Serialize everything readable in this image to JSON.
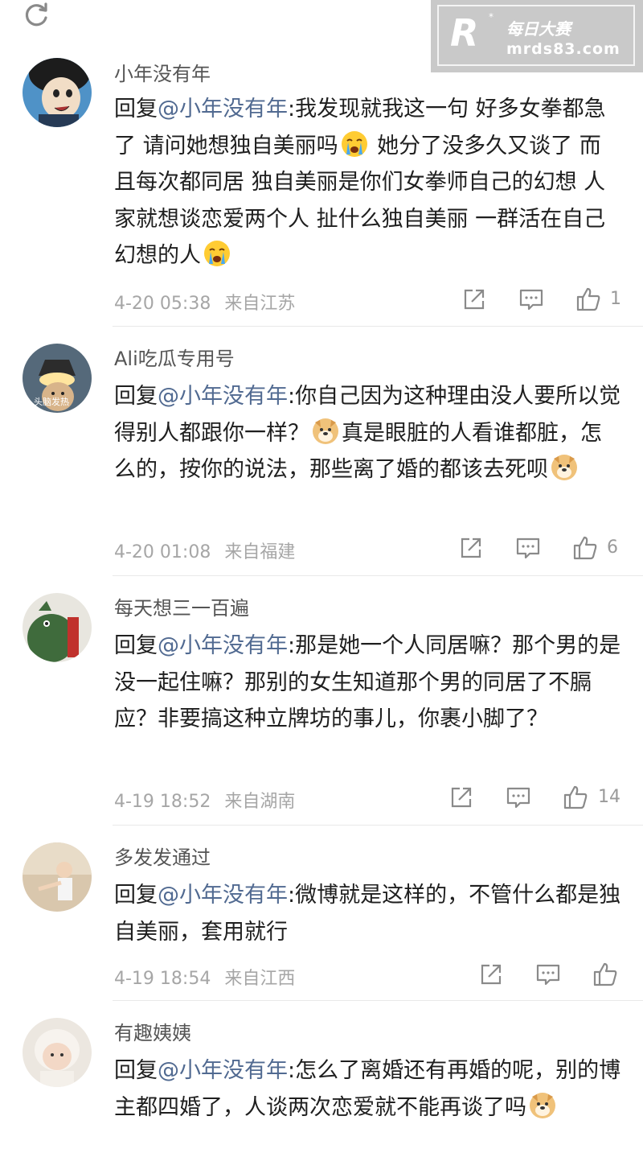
{
  "watermark": {
    "title": "每日大赛",
    "url": "mrds83.com",
    "logo_letter": "R",
    "logo_star": "*"
  },
  "comments": [
    {
      "username": "小年没有年",
      "prefix": "回复",
      "mention": "@小年没有年",
      "text_parts": [
        ":我发现就我这一句 好多女拳都急了 请问她想独自美丽吗",
        "[cry]",
        " 她分了没多久又谈了 而且每次都同居 独自美丽是你们女拳师自己的幻想 人家就想谈恋爱两个人 扯什么独自美丽 一群活在自己幻想的人",
        "[cry]"
      ],
      "time": "4-20 05:38",
      "location": "来自江苏",
      "likes": "1"
    },
    {
      "username": "Ali吃瓜专用号",
      "prefix": "回复",
      "mention": "@小年没有年",
      "text_parts": [
        ":你自己因为这种理由没人要所以觉得别人都跟你一样？",
        "[doge]",
        "真是眼脏的人看谁都脏，怎么的，按你的说法，那些离了婚的都该去死呗",
        "[doge]"
      ],
      "time": "4-20 01:08",
      "location": "来自福建",
      "likes": "6",
      "avatar_caption": "头脑发热"
    },
    {
      "username": "每天想三一百遍",
      "prefix": "回复",
      "mention": "@小年没有年",
      "text_parts": [
        ":那是她一个人同居嘛？那个男的是没一起住嘛？那别的女生知道那个男的同居了不膈应？非要搞这种立牌坊的事儿，你裹小脚了？"
      ],
      "time": "4-19 18:52",
      "location": "来自湖南",
      "likes": "14"
    },
    {
      "username": "多发发通过",
      "prefix": "回复",
      "mention": "@小年没有年",
      "text_parts": [
        ":微博就是这样的，不管什么都是独自美丽，套用就行"
      ],
      "time": "4-19 18:54",
      "location": "来自江西",
      "likes": ""
    },
    {
      "username": "有趣姨姨",
      "prefix": "回复",
      "mention": "@小年没有年",
      "text_parts": [
        ":怎么了离婚还有再婚的呢，别的博主都四婚了，人谈两次恋爱就不能再谈了吗",
        "[doge]"
      ],
      "time": "",
      "location": "",
      "likes": ""
    }
  ],
  "icons": {
    "refresh": "refresh-icon",
    "share": "share-icon",
    "comment": "comment-icon",
    "like": "like-icon"
  },
  "colors": {
    "mention": "#516a91",
    "meta": "#a6a6a6",
    "username": "#555555"
  }
}
